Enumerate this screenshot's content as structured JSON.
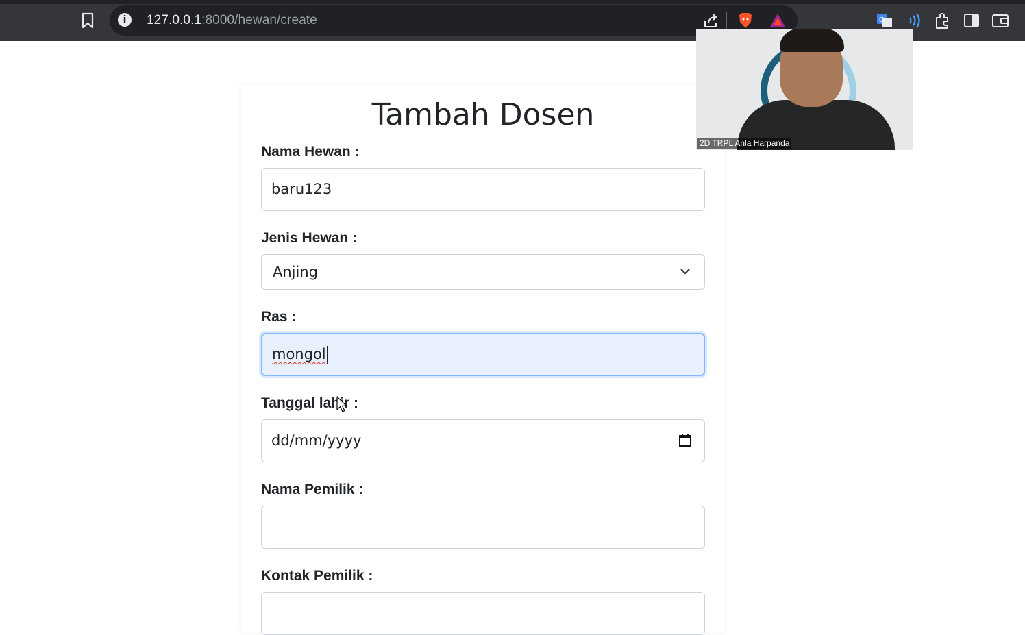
{
  "browser": {
    "url_host": "127.0.0.1",
    "url_rest": ":8000/hewan/create",
    "icons": [
      "bookmark-icon",
      "info-icon",
      "share-icon",
      "brave-shield-icon",
      "brave-rewards-icon",
      "translate-icon",
      "wallet-audio-icon",
      "extensions-icon",
      "sidebar-icon",
      "wallet-icon"
    ]
  },
  "page": {
    "title": "Tambah Dosen"
  },
  "form": {
    "nama_hewan_label": "Nama Hewan :",
    "nama_hewan_value": "baru123",
    "jenis_hewan_label": "Jenis Hewan :",
    "jenis_hewan_value": "Anjing",
    "ras_label": "Ras :",
    "ras_value": "mongol",
    "tanggal_lahir_label": "Tanggal lahir :",
    "tanggal_lahir_placeholder": "dd/mm/yyyy",
    "nama_pemilik_label": "Nama Pemilik :",
    "nama_pemilik_value": "",
    "kontak_pemilik_label": "Kontak Pemilik :",
    "kontak_pemilik_value": ""
  },
  "webcam": {
    "participant_name": "2D TRPL Anla Harpanda"
  },
  "colors": {
    "toolbar_bg": "#35363a",
    "omnibox_bg": "#202124",
    "focus_border": "#86b7fe",
    "focus_bg": "#e8f0fe"
  }
}
